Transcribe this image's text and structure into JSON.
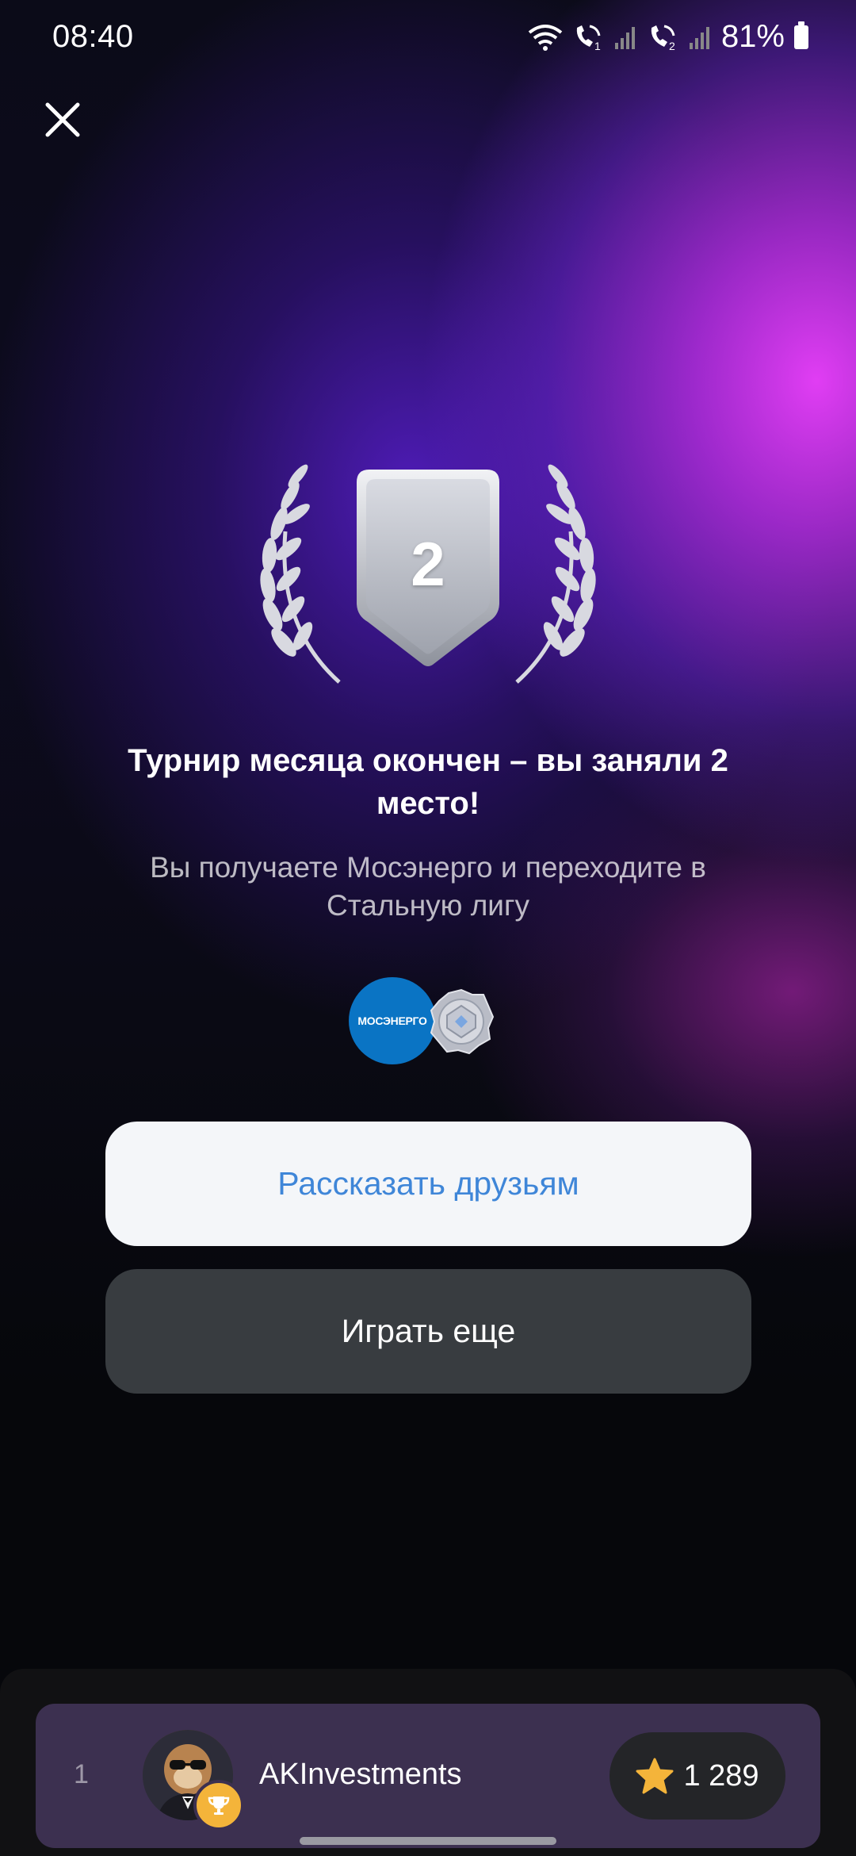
{
  "status_bar": {
    "time": "08:40",
    "battery": "81%",
    "sim1_label": "1",
    "sim2_label": "2"
  },
  "award": {
    "place": "2"
  },
  "result": {
    "title": "Турнир месяца окончен – вы заняли 2 место!",
    "subtitle": "Вы получаете Мосэнерго и переходите в Стальную лигу"
  },
  "rewards": {
    "company_logo_text": "МОСЭНЕРГО",
    "league_badge_icon": "steel-league-badge-icon"
  },
  "buttons": {
    "share_label": "Рассказать друзьям",
    "play_again_label": "Играть еще"
  },
  "leaderboard": {
    "rank": "1",
    "username": "AKInvestments",
    "score": "1 289"
  },
  "colors": {
    "accent_blue": "#3f86d8",
    "share_bg": "#f4f6f9",
    "play_bg": "#383c40",
    "leader_row_bg": "#3c3050",
    "star": "#f4b43a",
    "mosenergo_blue": "#0a74c4"
  }
}
